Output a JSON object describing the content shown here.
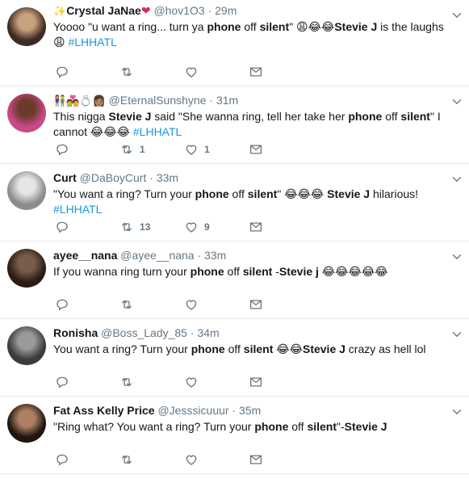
{
  "tweets": [
    {
      "name": "Crystal JaNae",
      "name_prefix": "✨",
      "name_suffix": "❤",
      "handle": "@hov1O3",
      "sep": "·",
      "time": "29m",
      "text_parts": [
        {
          "t": "Yoooo \"u want a ring... turn ya ",
          "s": "plain"
        },
        {
          "t": "phone",
          "s": "bold"
        },
        {
          "t": " off ",
          "s": "plain"
        },
        {
          "t": "silent",
          "s": "bold"
        },
        {
          "t": "\" 😩😂😂",
          "s": "plain"
        },
        {
          "t": "Stevie J",
          "s": "bold"
        },
        {
          "t": " is the laughs😩 ",
          "s": "plain"
        },
        {
          "t": "#LHHATL",
          "s": "tag"
        }
      ],
      "reply_count": "",
      "retweet_count": "",
      "like_count": "",
      "avatar_colors": [
        "#3d2a22",
        "#c9a17e"
      ]
    },
    {
      "name": "",
      "name_prefix": "👫💑💍👩🏽",
      "name_suffix": "",
      "handle": "@EternalSunshyne",
      "sep": "·",
      "time": "31m",
      "text_parts": [
        {
          "t": "This nigga ",
          "s": "plain"
        },
        {
          "t": "Stevie J",
          "s": "bold"
        },
        {
          "t": " said \"She wanna ring, tell her take her ",
          "s": "plain"
        },
        {
          "t": "phone",
          "s": "bold"
        },
        {
          "t": " off ",
          "s": "plain"
        },
        {
          "t": "silent",
          "s": "bold"
        },
        {
          "t": "\" I cannot 😂😂😂 ",
          "s": "plain"
        },
        {
          "t": "#LHHATL",
          "s": "tag"
        }
      ],
      "reply_count": "",
      "retweet_count": "1",
      "like_count": "1",
      "avatar_colors": [
        "#c94a86",
        "#6b3a2a"
      ]
    },
    {
      "name": "Curt",
      "name_prefix": "",
      "name_suffix": "",
      "handle": "@DaBoyCurt",
      "sep": "·",
      "time": "33m",
      "text_parts": [
        {
          "t": "\"You want a ring? Turn your ",
          "s": "plain"
        },
        {
          "t": "phone",
          "s": "bold"
        },
        {
          "t": " off ",
          "s": "plain"
        },
        {
          "t": "silent",
          "s": "bold"
        },
        {
          "t": "\" 😂😂😂 ",
          "s": "plain"
        },
        {
          "t": "Stevie J",
          "s": "bold"
        },
        {
          "t": " hilarious! ",
          "s": "plain"
        },
        {
          "t": "#LHHATL",
          "s": "tag"
        }
      ],
      "reply_count": "",
      "retweet_count": "13",
      "like_count": "9",
      "avatar_colors": [
        "#8d8d8d",
        "#e6e6e6"
      ]
    },
    {
      "name": "ayee__nana",
      "name_prefix": "",
      "name_suffix": "",
      "handle": "@ayee__nana",
      "sep": "·",
      "time": "33m",
      "text_parts": [
        {
          "t": "If you wanna ring turn your ",
          "s": "plain"
        },
        {
          "t": "phone",
          "s": "bold"
        },
        {
          "t": " off ",
          "s": "plain"
        },
        {
          "t": "silent",
          "s": "bold"
        },
        {
          "t": " -",
          "s": "plain"
        },
        {
          "t": "Stevie j",
          "s": "bold"
        },
        {
          "t": " 😂😂😂😂😂",
          "s": "plain"
        }
      ],
      "reply_count": "",
      "retweet_count": "",
      "like_count": "",
      "avatar_colors": [
        "#2b1d16",
        "#7a5c4a"
      ]
    },
    {
      "name": "Ronisha",
      "name_prefix": "",
      "name_suffix": "",
      "handle": "@Boss_Lady_85",
      "sep": "·",
      "time": "34m",
      "text_parts": [
        {
          "t": "You want a ring? Turn your ",
          "s": "plain"
        },
        {
          "t": "phone",
          "s": "bold"
        },
        {
          "t": " off ",
          "s": "plain"
        },
        {
          "t": "silent",
          "s": "bold"
        },
        {
          "t": " 😂😂",
          "s": "plain"
        },
        {
          "t": "Stevie J",
          "s": "bold"
        },
        {
          "t": " crazy as hell lol",
          "s": "plain"
        }
      ],
      "reply_count": "",
      "retweet_count": "",
      "like_count": "",
      "avatar_colors": [
        "#3b3b3b",
        "#9a9a9a"
      ]
    },
    {
      "name": "Fat Ass Kelly Price",
      "name_prefix": "",
      "name_suffix": "",
      "handle": "@Jesssicuuur",
      "sep": "·",
      "time": "35m",
      "text_parts": [
        {
          "t": "\"Ring what? You want a ring? Turn your ",
          "s": "plain"
        },
        {
          "t": "phone",
          "s": "bold"
        },
        {
          "t": " off ",
          "s": "plain"
        },
        {
          "t": "silent",
          "s": "bold"
        },
        {
          "t": "\"-",
          "s": "plain"
        },
        {
          "t": "Stevie J",
          "s": "bold"
        }
      ],
      "reply_count": "",
      "retweet_count": "",
      "like_count": "",
      "avatar_colors": [
        "#1f1410",
        "#b07f63"
      ]
    }
  ],
  "icons": {
    "reply": "reply-icon",
    "retweet": "retweet-icon",
    "like": "heart-icon",
    "dm": "envelope-icon",
    "menu": "chevron-down-icon"
  },
  "colors": {
    "link": "#1b95e0",
    "muted": "#657786",
    "text": "#14171a",
    "divider": "#e6ecf0",
    "heart": "#e0245e"
  }
}
